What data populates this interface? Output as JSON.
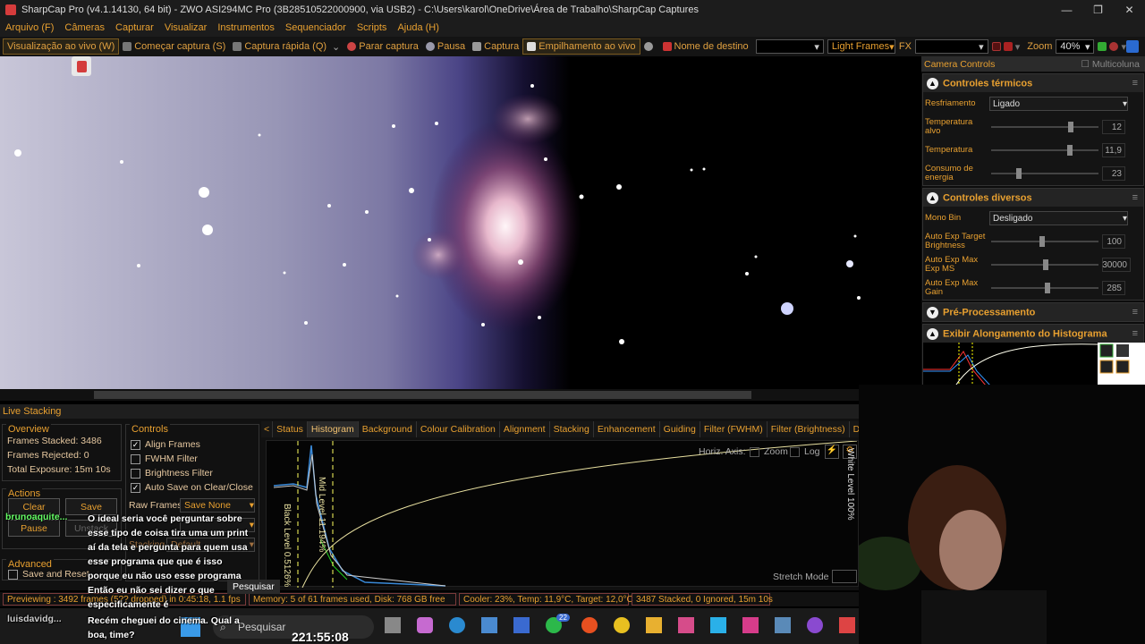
{
  "window": {
    "title": "SharpCap Pro (v4.1.14130, 64 bit) - ZWO ASI294MC Pro (3B28510522000900, via USB2) - C:\\Users\\karol\\OneDrive\\Área de Trabalho\\SharpCap Captures",
    "minimize": "—",
    "maximize": "❐",
    "close": "✕"
  },
  "menu": [
    "Arquivo (F)",
    "Câmeras",
    "Capturar",
    "Visualizar",
    "Instrumentos",
    "Sequenciador",
    "Scripts",
    "Ajuda (H)"
  ],
  "toolbar": {
    "live_view": "Visualização ao vivo (W)",
    "start_capture": "Começar captura (S)",
    "quick_capture": "Captura rápida (Q)",
    "stop_capture": "Parar captura",
    "pause": "Pausa",
    "capture": "Captura",
    "live_stacking": "Empilhamento ao vivo",
    "target_name_label": "Nome de destino",
    "target_name_value": "",
    "frame_type": "Light Frames",
    "fx_label": "FX",
    "fx_value": "",
    "zoom_label": "Zoom",
    "zoom_value": "40%"
  },
  "right_panel": {
    "header": "Camera Controls",
    "multicolumn": "Multicoluna",
    "thermal": {
      "title": "Controles térmicos",
      "cooling_label": "Resfriamento",
      "cooling_value": "Ligado",
      "target_temp_label": "Temperatura alvo",
      "target_temp_value": "12",
      "target_temp_level": 0.72,
      "temp_label": "Temperatura",
      "temp_value": "11,9",
      "temp_level": 0.71,
      "power_label": "Consumo de energia",
      "power_value": "23",
      "power_level": 0.23
    },
    "misc": {
      "title": "Controles diversos",
      "mono_bin_label": "Mono Bin",
      "mono_bin_value": "Desligado",
      "ae_target_label": "Auto Exp Target Brightness",
      "ae_target_value": "100",
      "ae_target_level": 0.45,
      "ae_maxexp_label": "Auto Exp Max Exp MS",
      "ae_maxexp_value": "30000",
      "ae_maxexp_level": 0.48,
      "ae_maxgain_label": "Auto Exp Max Gain",
      "ae_maxgain_value": "285",
      "ae_maxgain_level": 0.5
    },
    "preprocessing": "Pré-Processamento",
    "histogram_stretch": "Exibir Alongamento do Histograma"
  },
  "live_stacking": {
    "header": "Live Stacking",
    "overview": {
      "title": "Overview",
      "frames_stacked_label": "Frames Stacked:",
      "frames_stacked_value": "3486",
      "frames_rejected_label": "Frames Rejected:",
      "frames_rejected_value": "0",
      "total_exposure_label": "Total Exposure:",
      "total_exposure_value": "15m 10s"
    },
    "actions": {
      "title": "Actions",
      "clear": "Clear",
      "save": "Save",
      "pause": "Pause",
      "unstack": "Unstack"
    },
    "advanced": {
      "title": "Advanced",
      "save_and_reset": "Save and Reset"
    },
    "controls": {
      "title": "Controls",
      "align_frames": "Align Frames",
      "align_checked": true,
      "fwhm_filter": "FWHM Filter",
      "fwhm_checked": false,
      "brightness_filter": "Brightness Filter",
      "brightness_checked": false,
      "auto_save": "Auto Save on Clear/Close",
      "auto_save_checked": true,
      "raw_frames_label": "Raw Frames",
      "raw_frames_value": "Save None",
      "stacking_label": "Stacking",
      "stacking_value": "Default"
    },
    "tabs": [
      "Status",
      "Histogram",
      "Background",
      "Colour Calibration",
      "Alignment",
      "Stacking",
      "Enhancement",
      "Guiding",
      "Filter (FWHM)",
      "Filter (Brightness)",
      "Drift Gr"
    ],
    "active_tab": "Histogram",
    "histogram": {
      "horiz_axis_label": "Horiz. Axis:",
      "zoom": "Zoom",
      "log": "Log",
      "black_level": "Black Level 0.5126%",
      "mid_level": "Mid Level 11.194%",
      "white_level": "White Level 100%",
      "stretch_mode": "Stretch Mode"
    }
  },
  "status_bar": {
    "previewing": "Previewing : 3492 frames (5?? dropped) in 0:45:18, 1.1 fps",
    "memory": "Memory: 5 of 61 frames used, Disk: 768 GB free",
    "cooler": "Cooler: 23%, Temp: 11,9°C, Target: 12,0°C",
    "stacked": "3487 Stacked, 0 Ignored, 15m 10s"
  },
  "chat": {
    "user1": "brunoaquite...",
    "msg1": "O ideal seria você perguntar sobre esse tipo de coisa tira uma um print aí da tela e pergunta para quem usa esse programa que que é isso porque eu não uso esse programa Então eu não sei dizer o que especificamente é",
    "user2": "luisdavidg...",
    "msg2": "Recém cheguei do cinema. Qual a boa, time?",
    "tooltip": "Pesquisar"
  },
  "taskbar": {
    "search": "Pesquisar",
    "clock": "221:55:08",
    "badge": "22"
  },
  "colors": {
    "accent": "#e8a030",
    "bg": "#141414",
    "border": "#7a3a3a"
  }
}
